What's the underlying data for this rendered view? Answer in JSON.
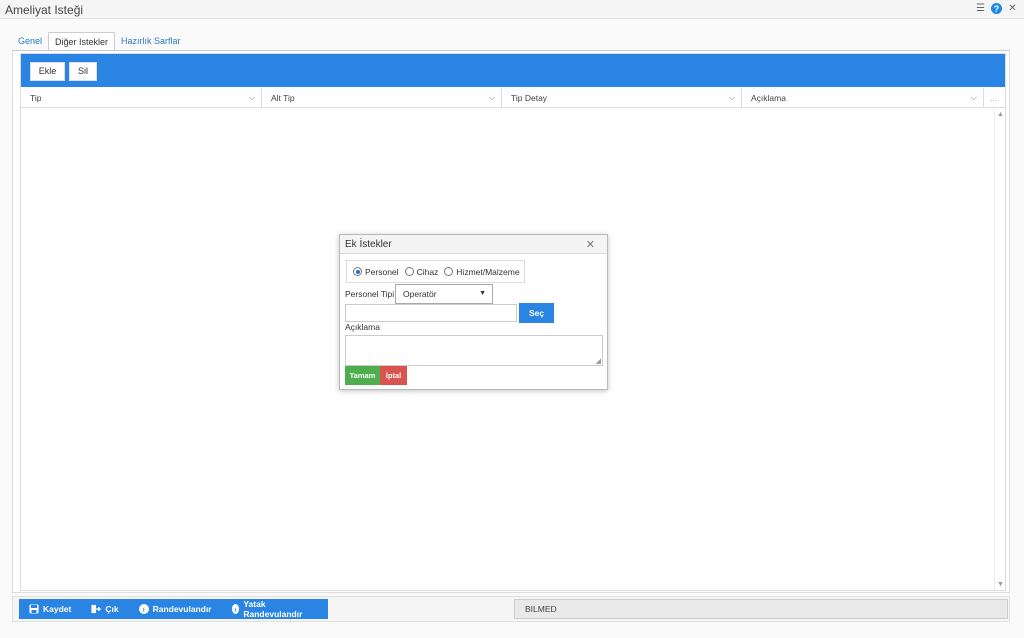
{
  "window": {
    "title": "Ameliyat Isteği",
    "icons": [
      "settings-sliders-icon",
      "help-icon",
      "close-icon"
    ]
  },
  "tabs": [
    {
      "label": "Genel",
      "active": false
    },
    {
      "label": "Diğer Istekler",
      "active": true
    },
    {
      "label": "Hazırlık Sarflar",
      "active": false
    }
  ],
  "toolbar": {
    "add_label": "Ekle",
    "delete_label": "Sil"
  },
  "grid": {
    "columns": [
      "Tip",
      "Alt Tip",
      "Tip Detay",
      "Açıklama"
    ],
    "more": "..."
  },
  "dialog": {
    "title": "Ek İstekler",
    "radio_options": [
      {
        "label": "Personel",
        "checked": true
      },
      {
        "label": "Cihaz",
        "checked": false
      },
      {
        "label": "Hizmet/Malzeme",
        "checked": false
      }
    ],
    "personel_tipi_label": "Personel Tipi",
    "personel_tipi_value": "Operatör",
    "select_label": "Seç",
    "aciklama_label": "Açıklama",
    "ok_label": "Tamam",
    "cancel_label": "İptal"
  },
  "footer": {
    "actions": [
      {
        "label": "Kaydet",
        "icon": "save-icon"
      },
      {
        "label": "Çık",
        "icon": "exit-icon"
      },
      {
        "label": "Randevulandır",
        "icon": "chevron-right-circle-icon"
      },
      {
        "label": "Yatak Randevulandır",
        "icon": "chevron-right-circle-icon"
      }
    ],
    "status": "BILMED"
  },
  "colors": {
    "accent": "#2a84e3",
    "ok": "#4cae4c",
    "cancel": "#d9534f"
  }
}
